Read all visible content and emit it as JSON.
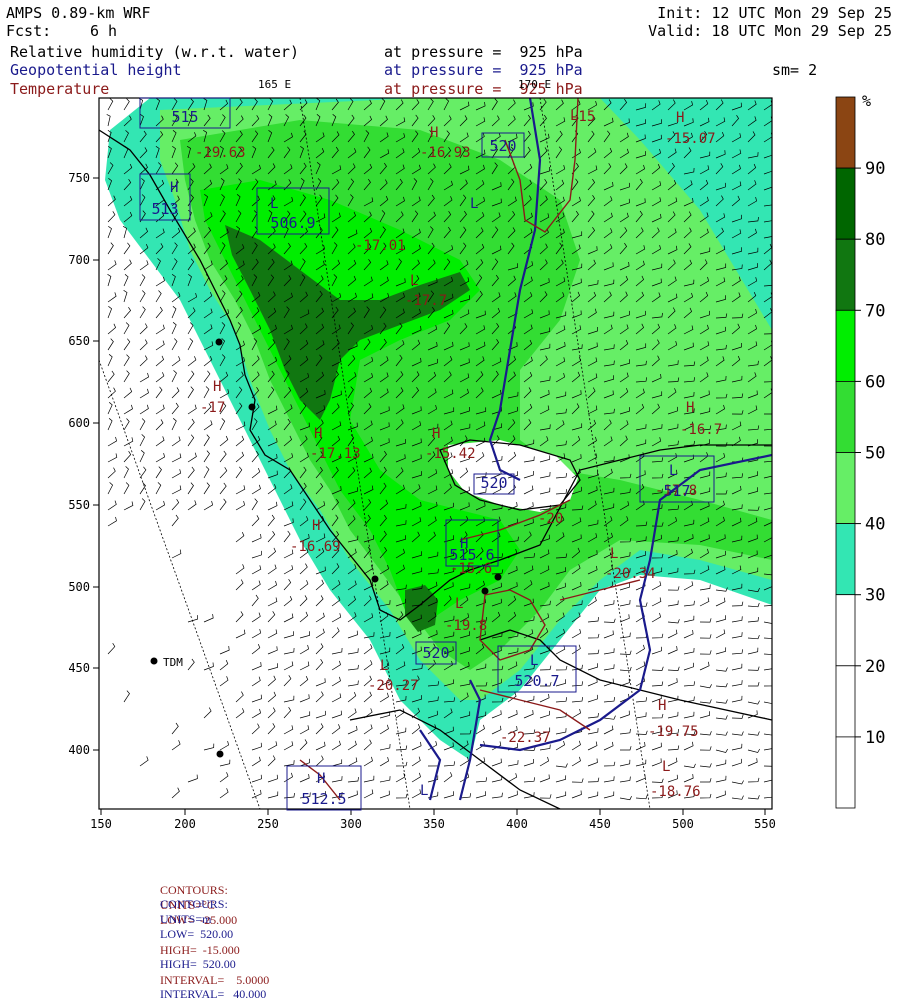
{
  "header": {
    "model": "AMPS 0.89-km WRF",
    "forecast_label": "Fcst:",
    "forecast_value": "6 h",
    "init": "Init: 12 UTC Mon 29 Sep 25",
    "valid": "Valid: 18 UTC Mon 29 Sep 25",
    "fields": [
      {
        "name": "Relative humidity (w.r.t. water)",
        "level": "at pressure =  925 hPa",
        "color": "#000000"
      },
      {
        "name": "Geopotential height",
        "level": "at pressure =  925 hPa",
        "color": "#1a1a8c"
      },
      {
        "name": "Temperature",
        "level": "at pressure =  925 hPa",
        "color": "#8b1a1a"
      }
    ],
    "smoothing": "sm= 2",
    "lon_165": "165 E",
    "lon_170": "170 E"
  },
  "colorbar": {
    "unit": "%",
    "ticks": [
      "10",
      "20",
      "30",
      "40",
      "50",
      "60",
      "70",
      "80",
      "90"
    ],
    "colors": [
      "#ffffff",
      "#ffffff",
      "#ffffff",
      "#33e6b3",
      "#66ee66",
      "#33dd33",
      "#00ee00",
      "#117711",
      "#006600",
      "#8b4513"
    ]
  },
  "axes": {
    "x_ticks": [
      "150",
      "200",
      "250",
      "300",
      "350",
      "400",
      "450",
      "500",
      "550"
    ],
    "y_ticks": [
      "400",
      "450",
      "500",
      "550",
      "600",
      "650",
      "700",
      "750"
    ]
  },
  "labels": {
    "station": "TDM",
    "temp_values": [
      "-16.93",
      "-15.07",
      "-17.01",
      "-17.7",
      "-17",
      "-17.13",
      "-15.42",
      "-16.7",
      "-16.69",
      "-20",
      "-20.27",
      "-22.37",
      "-19.8",
      "-20.34",
      "-19.75",
      "-18.76",
      "-19.63",
      "-15",
      "-15.6",
      "-17.8"
    ],
    "height_values": [
      "513",
      "506.9",
      "520",
      "520",
      "520",
      "520.7",
      "515",
      "517",
      "512.5",
      "515.6"
    ],
    "H": "H",
    "L": "L"
  },
  "footer": {
    "line1": {
      "label": "CONTOURS:",
      "units": "UNITS=°C",
      "low": "LOW=  -25.000",
      "high": "HIGH=  -15.000",
      "interval": "INTERVAL=    5.0000"
    },
    "line2": {
      "label": "CONTOURS:",
      "units": "UNITS=m",
      "low": "LOW=  520.00",
      "high": "HIGH=  520.00",
      "interval": "INTERVAL=   40.000"
    }
  }
}
